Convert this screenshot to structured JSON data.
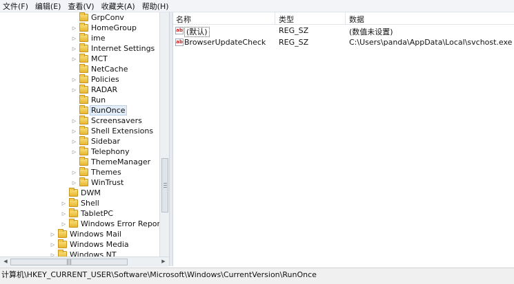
{
  "menu": [
    "文件(F)",
    "编辑(E)",
    "查看(V)",
    "收藏夹(A)",
    "帮助(H)"
  ],
  "tree": {
    "items": [
      {
        "label": "GrpConv",
        "expandable": false
      },
      {
        "label": "HomeGroup",
        "expandable": true
      },
      {
        "label": "ime",
        "expandable": true
      },
      {
        "label": "Internet Settings",
        "expandable": true
      },
      {
        "label": "MCT",
        "expandable": true
      },
      {
        "label": "NetCache",
        "expandable": false
      },
      {
        "label": "Policies",
        "expandable": true
      },
      {
        "label": "RADAR",
        "expandable": true
      },
      {
        "label": "Run",
        "expandable": false
      },
      {
        "label": "RunOnce",
        "expandable": false,
        "selected": true
      },
      {
        "label": "Screensavers",
        "expandable": true
      },
      {
        "label": "Shell Extensions",
        "expandable": true
      },
      {
        "label": "Sidebar",
        "expandable": true
      },
      {
        "label": "Telephony",
        "expandable": true
      },
      {
        "label": "ThemeManager",
        "expandable": false
      },
      {
        "label": "Themes",
        "expandable": true
      },
      {
        "label": "WinTrust",
        "expandable": true
      },
      {
        "label": "DWM",
        "expandable": false
      },
      {
        "label": "Shell",
        "expandable": true
      },
      {
        "label": "TabletPC",
        "expandable": true
      },
      {
        "label": "Windows Error Reporting",
        "expandable": true
      },
      {
        "label": "Windows Mail",
        "expandable": true
      },
      {
        "label": "Windows Media",
        "expandable": true
      },
      {
        "label": "Windows NT",
        "expandable": true
      }
    ]
  },
  "list": {
    "columns": [
      "名称",
      "类型",
      "数据"
    ],
    "rows": [
      {
        "name": "(默认)",
        "type": "REG_SZ",
        "data": "(数值未设置)"
      },
      {
        "name": "BrowserUpdateCheck",
        "type": "REG_SZ",
        "data": "C:\\Users\\panda\\AppData\\Local\\svchost.exe"
      }
    ]
  },
  "status_path": "计算机\\HKEY_CURRENT_USER\\Software\\Microsoft\\Windows\\CurrentVersion\\RunOnce",
  "icons": {
    "string_value": "ab",
    "expand": "▷"
  }
}
